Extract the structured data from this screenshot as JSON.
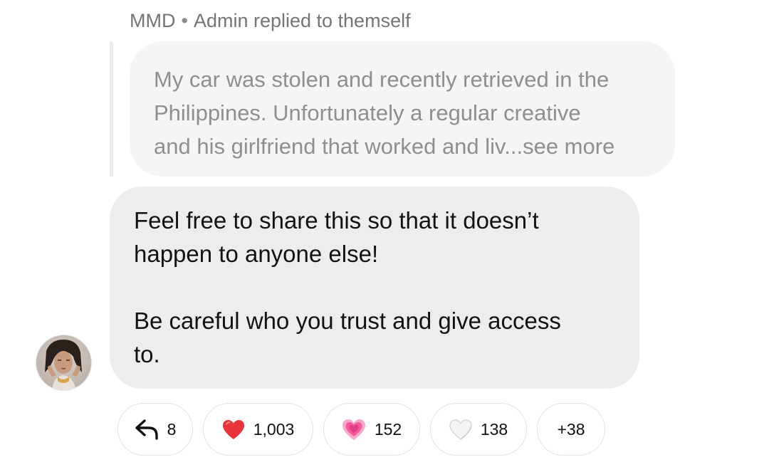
{
  "thread": {
    "author": "MMD",
    "separator": "•",
    "reply_text": "Admin replied to themself"
  },
  "quoted_message": {
    "lines": [
      "My car was stolen and recently retrieved in the",
      "Philippines.  Unfortunately a regular creative",
      "and his girlfriend that worked and liv...see more"
    ]
  },
  "message": {
    "paragraph1": [
      "Feel free to share this so that it doesn’t",
      "happen to anyone else!"
    ],
    "paragraph2": [
      "Be careful who you trust and give access",
      "to."
    ]
  },
  "reactions": {
    "reply": {
      "icon": "reply-arrow-icon",
      "count": "8"
    },
    "red_heart": {
      "icon": "red-heart-icon",
      "count": "1,003",
      "color": "#e8333a"
    },
    "pink_heart": {
      "icon": "growing-pink-heart-icon",
      "count": "152",
      "color": "#f25a9a"
    },
    "white_heart": {
      "icon": "white-heart-icon",
      "count": "138",
      "color": "#f2f2f2"
    },
    "more": {
      "label": "+38"
    }
  }
}
